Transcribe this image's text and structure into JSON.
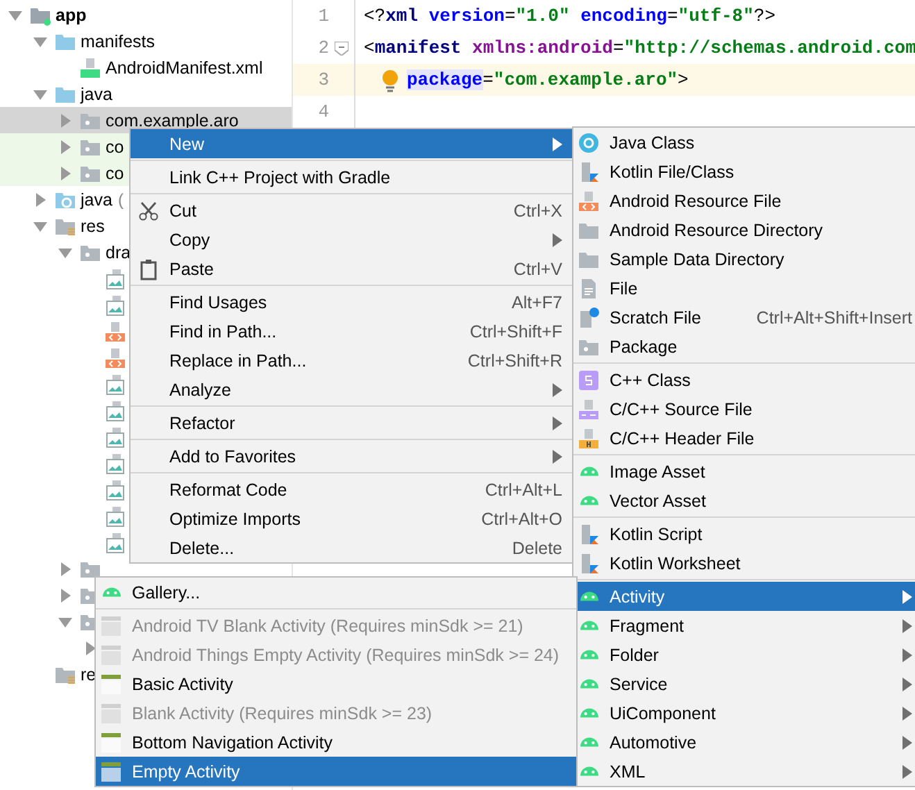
{
  "project_tree": [
    {
      "label": "app",
      "kind": "module",
      "expanded": true,
      "children": [
        {
          "label": "manifests",
          "kind": "folder",
          "expanded": true,
          "children": [
            {
              "label": "AndroidManifest.xml",
              "kind": "manifest"
            }
          ]
        },
        {
          "label": "java",
          "kind": "folder",
          "expanded": true,
          "children": [
            {
              "label": "com.example.aro",
              "kind": "package",
              "expanded": false,
              "selected": true
            },
            {
              "label": "co",
              "kind": "package",
              "expanded": false,
              "selected": false,
              "test_source": true
            },
            {
              "label": "co",
              "kind": "package",
              "expanded": false,
              "selected": false,
              "test_source": true
            }
          ]
        },
        {
          "label": "java",
          "hint": "(",
          "kind": "generated",
          "expanded": false
        },
        {
          "label": "res",
          "kind": "res",
          "expanded": true,
          "children": [
            {
              "label": "dra",
              "kind": "package",
              "expanded": true,
              "children": [
                {
                  "kind": "image"
                },
                {
                  "kind": "image"
                },
                {
                  "kind": "xml"
                },
                {
                  "kind": "xml"
                },
                {
                  "kind": "image"
                },
                {
                  "kind": "image"
                },
                {
                  "kind": "image"
                },
                {
                  "kind": "image"
                },
                {
                  "kind": "image"
                },
                {
                  "kind": "image"
                },
                {
                  "kind": "image"
                }
              ]
            },
            {
              "kind": "package",
              "expanded": false
            },
            {
              "kind": "package",
              "expanded": false
            },
            {
              "kind": "package",
              "expanded": true,
              "children": [
                {
                  "expanded": false
                }
              ]
            }
          ]
        },
        {
          "label": "re",
          "kind": "res"
        }
      ]
    }
  ],
  "editor": {
    "lines": [
      {
        "number": "1",
        "current": false,
        "tokens": [
          {
            "kind": "punct",
            "text": "<?"
          },
          {
            "kind": "tag",
            "text": "xml "
          },
          {
            "kind": "attr",
            "text": "version"
          },
          {
            "kind": "punct",
            "text": "="
          },
          {
            "kind": "value",
            "text": "\"1.0\" "
          },
          {
            "kind": "attr",
            "text": "encoding"
          },
          {
            "kind": "punct",
            "text": "="
          },
          {
            "kind": "value",
            "text": "\"utf-8\""
          },
          {
            "kind": "punct",
            "text": "?>"
          }
        ]
      },
      {
        "number": "2",
        "current": false,
        "tokens": [
          {
            "kind": "punct",
            "text": "<"
          },
          {
            "kind": "tag",
            "text": "manifest "
          },
          {
            "kind": "ns",
            "text": "xmlns:android"
          },
          {
            "kind": "punct",
            "text": "="
          },
          {
            "kind": "value",
            "text": "\"http://schemas.android.com"
          }
        ]
      },
      {
        "number": "3",
        "current": true,
        "indented": true,
        "tokens": [
          {
            "kind": "attr_hl",
            "text": "package"
          },
          {
            "kind": "punct",
            "text": "="
          },
          {
            "kind": "value",
            "text": "\"com.example.aro\""
          },
          {
            "kind": "punct",
            "text": ">"
          }
        ]
      },
      {
        "number": "4",
        "current": false
      }
    ]
  },
  "context_menu": [
    {
      "kind": "item",
      "label": "New",
      "has_submenu": true,
      "selected": true,
      "disabled": false
    },
    {
      "kind": "separator"
    },
    {
      "kind": "item",
      "label": "Link C++ Project with Gradle",
      "selected": false,
      "disabled": false
    },
    {
      "kind": "separator"
    },
    {
      "kind": "item",
      "label": "Cut",
      "shortcut": "Ctrl+X",
      "selected": false,
      "disabled": false
    },
    {
      "kind": "item",
      "label": "Copy",
      "has_submenu": true,
      "selected": false,
      "disabled": false
    },
    {
      "kind": "item",
      "label": "Paste",
      "shortcut": "Ctrl+V",
      "selected": false,
      "disabled": false
    },
    {
      "kind": "separator"
    },
    {
      "kind": "item",
      "label": "Find Usages",
      "shortcut": "Alt+F7",
      "selected": false,
      "disabled": false
    },
    {
      "kind": "item",
      "label": "Find in Path...",
      "shortcut": "Ctrl+Shift+F",
      "selected": false,
      "disabled": false
    },
    {
      "kind": "item",
      "label": "Replace in Path...",
      "shortcut": "Ctrl+Shift+R",
      "selected": false,
      "disabled": false
    },
    {
      "kind": "item",
      "label": "Analyze",
      "has_submenu": true,
      "selected": false,
      "disabled": false
    },
    {
      "kind": "separator"
    },
    {
      "kind": "item",
      "label": "Refactor",
      "has_submenu": true,
      "selected": false,
      "disabled": false
    },
    {
      "kind": "separator"
    },
    {
      "kind": "item",
      "label": "Add to Favorites",
      "has_submenu": true,
      "selected": false,
      "disabled": false
    },
    {
      "kind": "separator"
    },
    {
      "kind": "item",
      "label": "Reformat Code",
      "shortcut": "Ctrl+Alt+L",
      "selected": false,
      "disabled": false
    },
    {
      "kind": "item",
      "label": "Optimize Imports",
      "shortcut": "Ctrl+Alt+O",
      "selected": false,
      "disabled": false
    },
    {
      "kind": "item",
      "label": "Delete...",
      "shortcut": "Delete",
      "selected": false,
      "disabled": false
    }
  ],
  "new_submenu": [
    {
      "kind": "item",
      "label": "Java Class",
      "selected": false,
      "disabled": false
    },
    {
      "kind": "item",
      "label": "Kotlin File/Class",
      "selected": false,
      "disabled": false
    },
    {
      "kind": "item",
      "label": "Android Resource File",
      "selected": false,
      "disabled": false
    },
    {
      "kind": "item",
      "label": "Android Resource Directory",
      "selected": false,
      "disabled": false
    },
    {
      "kind": "item",
      "label": "Sample Data Directory",
      "selected": false,
      "disabled": false
    },
    {
      "kind": "item",
      "label": "File",
      "selected": false,
      "disabled": false
    },
    {
      "kind": "item",
      "label": "Scratch File",
      "shortcut": "Ctrl+Alt+Shift+Insert",
      "selected": false,
      "disabled": false
    },
    {
      "kind": "item",
      "label": "Package",
      "selected": false,
      "disabled": false
    },
    {
      "kind": "separator"
    },
    {
      "kind": "item",
      "label": "C++ Class",
      "selected": false,
      "disabled": false
    },
    {
      "kind": "item",
      "label": "C/C++ Source File",
      "selected": false,
      "disabled": false
    },
    {
      "kind": "item",
      "label": "C/C++ Header File",
      "selected": false,
      "disabled": false
    },
    {
      "kind": "separator"
    },
    {
      "kind": "item",
      "label": "Image Asset",
      "selected": false,
      "disabled": false
    },
    {
      "kind": "item",
      "label": "Vector Asset",
      "selected": false,
      "disabled": false
    },
    {
      "kind": "separator"
    },
    {
      "kind": "item",
      "label": "Kotlin Script",
      "selected": false,
      "disabled": false
    },
    {
      "kind": "item",
      "label": "Kotlin Worksheet",
      "selected": false,
      "disabled": false
    },
    {
      "kind": "separator"
    },
    {
      "kind": "item",
      "label": "Activity",
      "has_submenu": true,
      "selected": true,
      "disabled": false
    },
    {
      "kind": "item",
      "label": "Fragment",
      "has_submenu": true,
      "selected": false,
      "disabled": false
    },
    {
      "kind": "item",
      "label": "Folder",
      "has_submenu": true,
      "selected": false,
      "disabled": false
    },
    {
      "kind": "item",
      "label": "Service",
      "has_submenu": true,
      "selected": false,
      "disabled": false
    },
    {
      "kind": "item",
      "label": "UiComponent",
      "has_submenu": true,
      "selected": false,
      "disabled": false
    },
    {
      "kind": "item",
      "label": "Automotive",
      "has_submenu": true,
      "selected": false,
      "disabled": false
    },
    {
      "kind": "item",
      "label": "XML",
      "has_submenu": true,
      "selected": false,
      "disabled": false
    }
  ],
  "activity_submenu": [
    {
      "kind": "item",
      "label": "Gallery...",
      "selected": false,
      "disabled": false
    },
    {
      "kind": "separator"
    },
    {
      "kind": "item",
      "label": "Android TV Blank Activity (Requires minSdk >= 21)",
      "selected": false,
      "disabled": true
    },
    {
      "kind": "item",
      "label": "Android Things Empty Activity (Requires minSdk >= 24)",
      "selected": false,
      "disabled": true
    },
    {
      "kind": "item",
      "label": "Basic Activity",
      "selected": false,
      "disabled": false
    },
    {
      "kind": "item",
      "label": "Blank Activity (Requires minSdk >= 23)",
      "selected": false,
      "disabled": true
    },
    {
      "kind": "item",
      "label": "Bottom Navigation Activity",
      "selected": false,
      "disabled": false
    },
    {
      "kind": "item",
      "label": "Empty Activity",
      "selected": true,
      "disabled": false
    }
  ]
}
